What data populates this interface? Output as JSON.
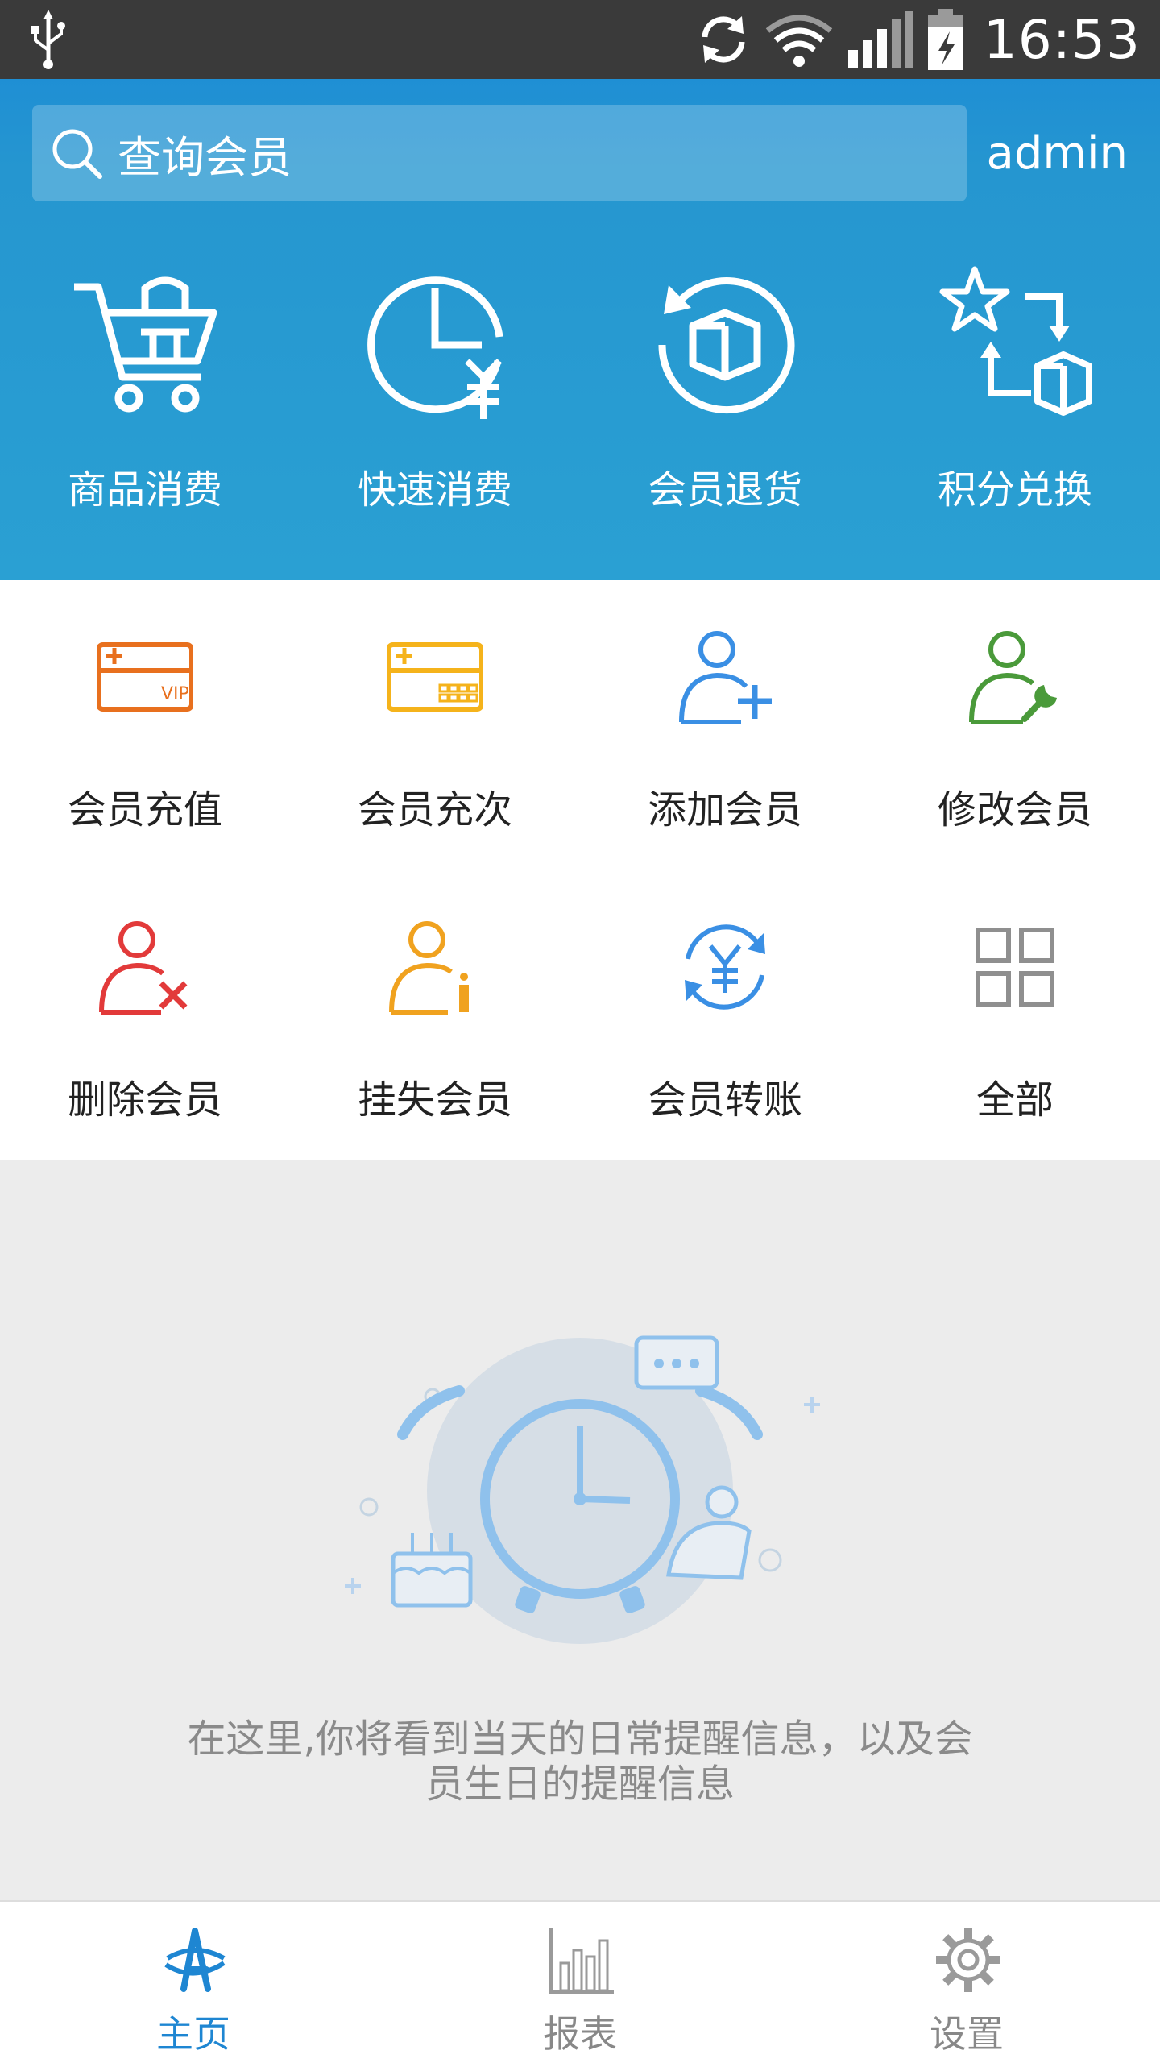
{
  "status_bar": {
    "time": "16:53"
  },
  "search": {
    "placeholder": "查询会员"
  },
  "user": {
    "name": "admin"
  },
  "quick_actions": [
    {
      "label": "商品消费",
      "icon": "cart-icon"
    },
    {
      "label": "快速消费",
      "icon": "clock-yen-icon"
    },
    {
      "label": "会员退货",
      "icon": "return-box-icon"
    },
    {
      "label": "积分兑换",
      "icon": "points-exchange-icon"
    }
  ],
  "functions": [
    {
      "label": "会员充值",
      "icon": "vip-card-icon",
      "color": "#e8701e"
    },
    {
      "label": "会员充次",
      "icon": "card-count-icon",
      "color": "#f5b31b"
    },
    {
      "label": "添加会员",
      "icon": "add-user-icon",
      "color": "#3a8fe4"
    },
    {
      "label": "修改会员",
      "icon": "edit-user-icon",
      "color": "#4a9a3a"
    },
    {
      "label": "删除会员",
      "icon": "delete-user-icon",
      "color": "#e23a3a"
    },
    {
      "label": "挂失会员",
      "icon": "report-loss-user-icon",
      "color": "#f0a21f"
    },
    {
      "label": "会员转账",
      "icon": "transfer-yen-icon",
      "color": "#3a8fe4"
    },
    {
      "label": "全部",
      "icon": "grid-icon",
      "color": "#8f8f8f"
    }
  ],
  "reminder": {
    "message_line1": "在这里,你将看到当天的日常提醒信息，以及会",
    "message_line2": "员生日的提醒信息"
  },
  "tabs": [
    {
      "label": "主页",
      "icon": "home-logo-icon",
      "active": true
    },
    {
      "label": "报表",
      "icon": "bar-chart-icon",
      "active": false
    },
    {
      "label": "设置",
      "icon": "gear-icon",
      "active": false
    }
  ],
  "colors": {
    "header_blue": "#2596d0",
    "active_tab": "#1e86d2"
  }
}
